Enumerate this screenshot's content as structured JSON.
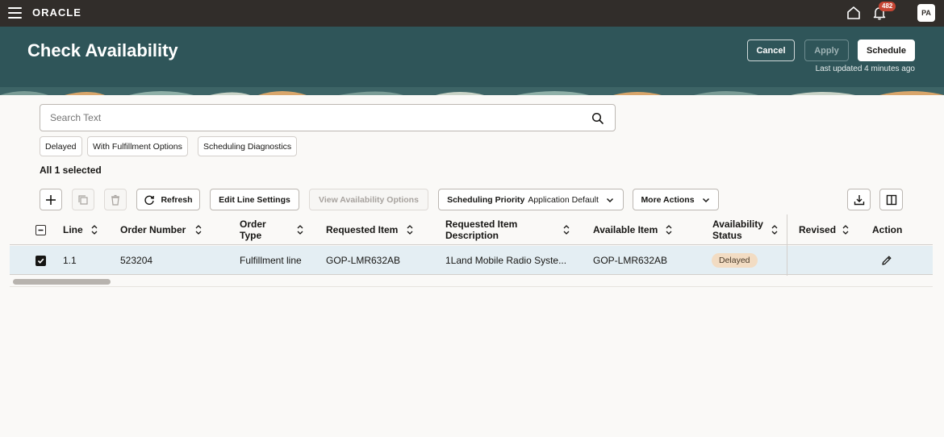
{
  "app": {
    "logo": "ORACLE",
    "notifications_count": "482",
    "avatar_initials": "PA"
  },
  "header": {
    "title": "Check Availability",
    "cancel_label": "Cancel",
    "apply_label": "Apply",
    "schedule_label": "Schedule",
    "last_updated": "Last updated 4 minutes ago"
  },
  "search": {
    "placeholder": "Search Text"
  },
  "filters": [
    "Delayed",
    "With Fulfillment Options",
    "Scheduling Diagnostics"
  ],
  "selection": {
    "label": "All 1 selected"
  },
  "toolbar": {
    "refresh_label": "Refresh",
    "edit_line_settings_label": "Edit Line Settings",
    "view_availability_options_label": "View Availability Options",
    "scheduling_priority_label": "Scheduling Priority",
    "scheduling_priority_value": "Application Default",
    "more_actions_label": "More Actions"
  },
  "table": {
    "columns": {
      "line": "Line",
      "order_number": "Order Number",
      "order_type": "Order Type",
      "requested_item": "Requested Item",
      "requested_item_description": "Requested Item Description",
      "available_item": "Available Item",
      "availability_status": "Availability Status",
      "revised": "Revised",
      "action": "Action"
    },
    "rows": [
      {
        "line": "1.1",
        "order_number": "523204",
        "order_type": "Fulfillment line",
        "requested_item": "GOP-LMR632AB",
        "requested_item_description": "1Land Mobile Radio Syste...",
        "available_item": "GOP-LMR632AB",
        "availability_status": "Delayed",
        "revised": ""
      }
    ]
  },
  "colors": {
    "topbar": "#312d2a",
    "banner": "#2f5559",
    "row_selected": "#e4eef3",
    "status_delayed": "#f2dcc3",
    "badge": "#c74634"
  }
}
